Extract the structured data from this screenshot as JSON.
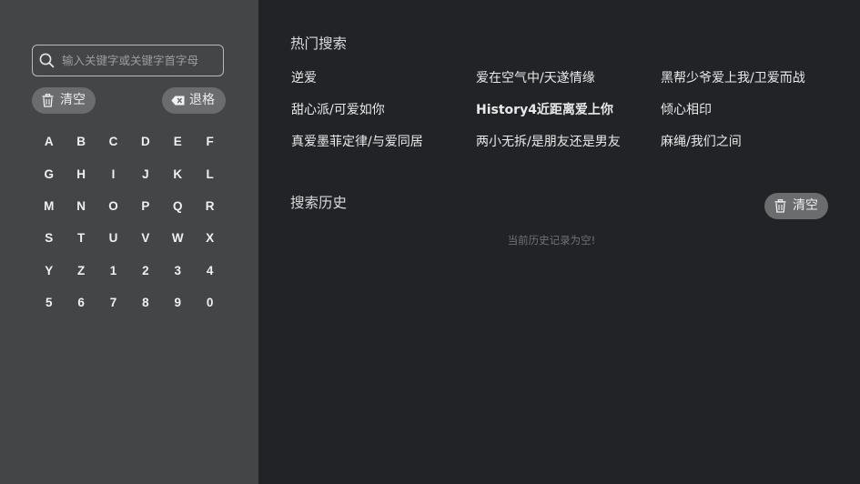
{
  "left_panel": {
    "search": {
      "placeholder": "输入关键字或关键字首字母",
      "icon": "search-icon"
    },
    "clear_button": {
      "label": "清空",
      "icon": "trash-icon"
    },
    "backspace_button": {
      "label": "退格",
      "icon": "backspace-icon"
    },
    "keys": [
      "A",
      "B",
      "C",
      "D",
      "E",
      "F",
      "G",
      "H",
      "I",
      "J",
      "K",
      "L",
      "M",
      "N",
      "O",
      "P",
      "Q",
      "R",
      "S",
      "T",
      "U",
      "V",
      "W",
      "X",
      "Y",
      "Z",
      "1",
      "2",
      "3",
      "4",
      "5",
      "6",
      "7",
      "8",
      "9",
      "0"
    ]
  },
  "hot_search": {
    "title": "热门搜索",
    "items": [
      "逆爱",
      "爱在空气中/天遂情缘",
      "黑帮少爷爱上我/卫爱而战",
      "甜心派/可爱如你",
      "History4近距离爱上你",
      "倾心相印",
      "真爱墨菲定律/与爱同居",
      "两小无拆/是朋友还是男友",
      "麻绳/我们之间"
    ]
  },
  "history": {
    "title": "搜索历史",
    "clear_button": {
      "label": "清空",
      "icon": "trash-icon"
    },
    "empty_message": "当前历史记录为空!"
  },
  "colors": {
    "left_panel_bg": "#434546",
    "right_panel_bg": "#212327",
    "pill_bg": "#6a6c6d"
  }
}
